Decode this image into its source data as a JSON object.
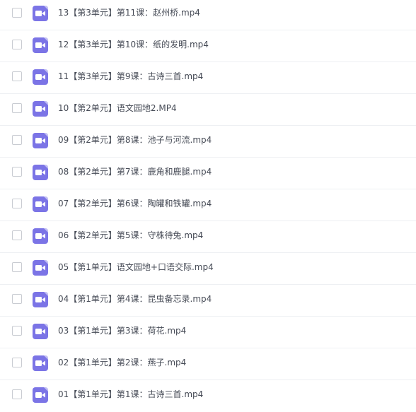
{
  "files": [
    {
      "name": "13【第3单元】第11课：赵州桥.mp4",
      "icon": "video-file-icon"
    },
    {
      "name": "12【第3单元】第10课：纸的发明.mp4",
      "icon": "video-file-icon"
    },
    {
      "name": "11【第3单元】第9课：古诗三首.mp4",
      "icon": "video-file-icon"
    },
    {
      "name": "10【第2单元】语文园地2.MP4",
      "icon": "video-file-icon"
    },
    {
      "name": "09【第2单元】第8课：池子与河流.mp4",
      "icon": "video-file-icon"
    },
    {
      "name": "08【第2单元】第7课：鹿角和鹿腿.mp4",
      "icon": "video-file-icon"
    },
    {
      "name": "07【第2单元】第6课：陶罐和铁罐.mp4",
      "icon": "video-file-icon"
    },
    {
      "name": "06【第2单元】第5课：守株待兔.mp4",
      "icon": "video-file-icon"
    },
    {
      "name": "05【第1单元】语文园地+口语交际.mp4",
      "icon": "video-file-icon"
    },
    {
      "name": "04【第1单元】第4课：昆虫备忘录.mp4",
      "icon": "video-file-icon"
    },
    {
      "name": "03【第1单元】第3课：荷花.mp4",
      "icon": "video-file-icon"
    },
    {
      "name": "02【第1单元】第2课：燕子.mp4",
      "icon": "video-file-icon"
    },
    {
      "name": "01【第1单元】第1课：古诗三首.mp4",
      "icon": "video-file-icon"
    }
  ],
  "colors": {
    "icon_background": "#7b74e6",
    "text": "#464b56",
    "divider": "#eef0f3",
    "checkbox_border": "#c9ccd2"
  }
}
